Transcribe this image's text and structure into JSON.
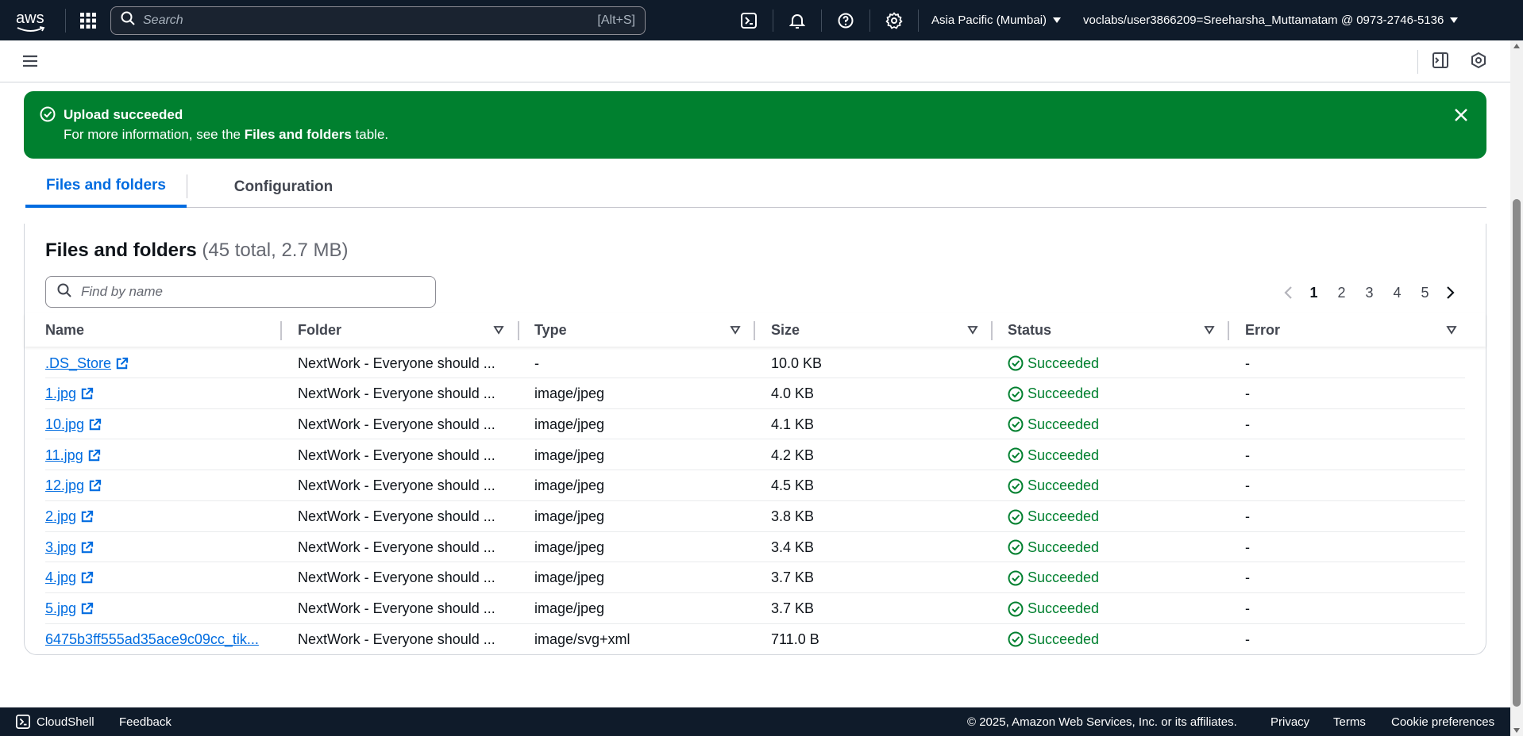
{
  "topnav": {
    "logo_text": "aws",
    "search_placeholder": "Search",
    "search_shortcut": "[Alt+S]",
    "region": "Asia Pacific (Mumbai)",
    "account": "voclabs/user3866209=Sreeharsha_Muttamatam @ 0973-2746-5136"
  },
  "flash": {
    "title": "Upload succeeded",
    "body_prefix": "For more information, see the ",
    "body_bold": "Files and folders",
    "body_suffix": " table."
  },
  "tabs": {
    "files": "Files and folders",
    "config": "Configuration"
  },
  "table": {
    "title": "Files and folders",
    "count": "(45 total, 2.7 MB)",
    "find_placeholder": "Find by name",
    "pages": [
      "1",
      "2",
      "3",
      "4",
      "5"
    ],
    "columns": [
      "Name",
      "Folder",
      "Type",
      "Size",
      "Status",
      "Error"
    ],
    "rows": [
      {
        "name": ".DS_Store",
        "folder": "NextWork - Everyone should ...",
        "type": "-",
        "size": "10.0 KB",
        "status": "Succeeded",
        "error": "-"
      },
      {
        "name": "1.jpg",
        "folder": "NextWork - Everyone should ...",
        "type": "image/jpeg",
        "size": "4.0 KB",
        "status": "Succeeded",
        "error": "-"
      },
      {
        "name": "10.jpg",
        "folder": "NextWork - Everyone should ...",
        "type": "image/jpeg",
        "size": "4.1 KB",
        "status": "Succeeded",
        "error": "-"
      },
      {
        "name": "11.jpg",
        "folder": "NextWork - Everyone should ...",
        "type": "image/jpeg",
        "size": "4.2 KB",
        "status": "Succeeded",
        "error": "-"
      },
      {
        "name": "12.jpg",
        "folder": "NextWork - Everyone should ...",
        "type": "image/jpeg",
        "size": "4.5 KB",
        "status": "Succeeded",
        "error": "-"
      },
      {
        "name": "2.jpg",
        "folder": "NextWork - Everyone should ...",
        "type": "image/jpeg",
        "size": "3.8 KB",
        "status": "Succeeded",
        "error": "-"
      },
      {
        "name": "3.jpg",
        "folder": "NextWork - Everyone should ...",
        "type": "image/jpeg",
        "size": "3.4 KB",
        "status": "Succeeded",
        "error": "-"
      },
      {
        "name": "4.jpg",
        "folder": "NextWork - Everyone should ...",
        "type": "image/jpeg",
        "size": "3.7 KB",
        "status": "Succeeded",
        "error": "-"
      },
      {
        "name": "5.jpg",
        "folder": "NextWork - Everyone should ...",
        "type": "image/jpeg",
        "size": "3.7 KB",
        "status": "Succeeded",
        "error": "-"
      },
      {
        "name": "6475b3ff555ad35ace9c09cc_tik...",
        "folder": "NextWork - Everyone should ...",
        "type": "image/svg+xml",
        "size": "711.0 B",
        "status": "Succeeded",
        "error": "-"
      }
    ]
  },
  "footer": {
    "cloudshell": "CloudShell",
    "feedback": "Feedback",
    "copyright": "© 2025, Amazon Web Services, Inc. or its affiliates.",
    "privacy": "Privacy",
    "terms": "Terms",
    "cookie": "Cookie preferences"
  },
  "colors": {
    "nav_bg": "#0f1b2a",
    "success": "#00802f",
    "link": "#006ce0"
  }
}
